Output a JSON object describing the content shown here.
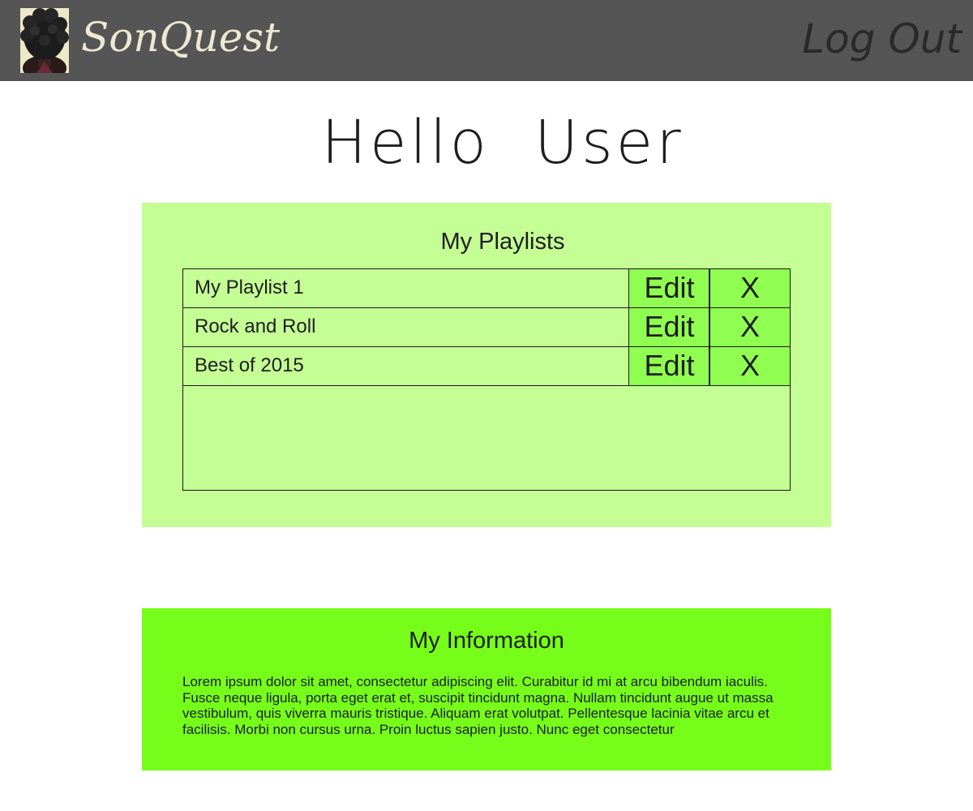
{
  "header": {
    "brand": "SonQuest",
    "avatar_icon": "user-avatar-icon",
    "logout_label": "Log Out"
  },
  "greeting": "Hello  User",
  "playlists": {
    "title": "My Playlists",
    "items": [
      {
        "name": "My Playlist 1",
        "edit_label": "Edit",
        "delete_label": "X"
      },
      {
        "name": "Rock and Roll",
        "edit_label": "Edit",
        "delete_label": "X"
      },
      {
        "name": "Best of 2015",
        "edit_label": "Edit",
        "delete_label": "X"
      }
    ]
  },
  "information": {
    "title": "My Information",
    "text": "Lorem ipsum dolor sit amet, consectetur adipiscing elit. Curabitur id mi at arcu bibendum iaculis. Fusce neque ligula, porta eget erat et, suscipit tincidunt magna. Nullam tincidunt augue ut massa vestibulum, quis viverra mauris tristique. Aliquam erat volutpat. Pellentesque lacinia vitae arcu et facilisis. Morbi non cursus urna. Proin luctus sapien justo. Nunc eget consectetur"
  },
  "colors": {
    "header_bg": "#555555",
    "playlists_panel_bg": "#c4fe95",
    "action_button_bg": "#90fd51",
    "info_panel_bg": "#76fe1a"
  }
}
